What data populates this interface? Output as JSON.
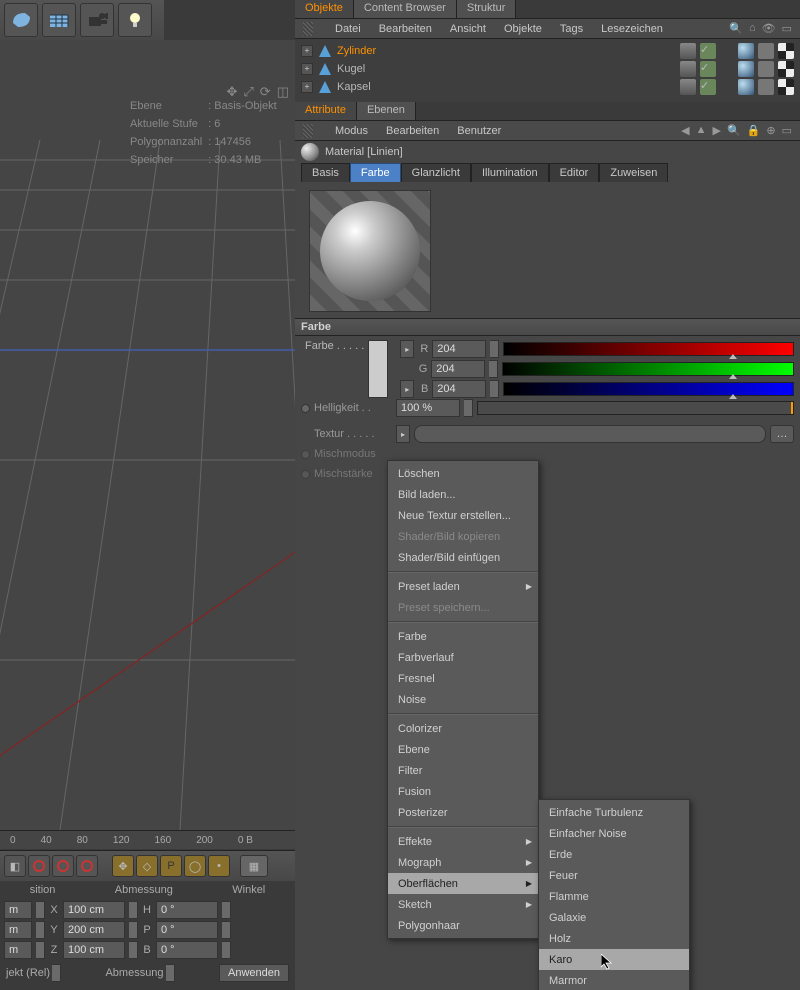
{
  "scene_info": {
    "rows": [
      [
        "Ebene",
        ": Basis-Objekt"
      ],
      [
        "Aktuelle Stufe",
        ": 6"
      ],
      [
        "Polygonanzahl",
        ": 147456"
      ],
      [
        "Speicher",
        ": 30.43 MB"
      ]
    ]
  },
  "ruler": [
    "0",
    "40",
    "80",
    "120",
    "160",
    "200",
    "0 B"
  ],
  "tabs_top": {
    "items": [
      "Objekte",
      "Content Browser",
      "Struktur"
    ],
    "active": "Objekte"
  },
  "obj_menu": {
    "items": [
      "Datei",
      "Bearbeiten",
      "Ansicht",
      "Objekte",
      "Tags",
      "Lesezeichen"
    ]
  },
  "objects": [
    {
      "name": "Zylinder",
      "selected": true
    },
    {
      "name": "Kugel",
      "selected": false
    },
    {
      "name": "Kapsel",
      "selected": false
    }
  ],
  "tabs_attr": {
    "items": [
      "Attribute",
      "Ebenen"
    ],
    "active": "Attribute"
  },
  "attr_menu": {
    "items": [
      "Modus",
      "Bearbeiten",
      "Benutzer"
    ]
  },
  "material_title": "Material [Linien]",
  "channels": {
    "items": [
      "Basis",
      "Farbe",
      "Glanzlicht",
      "Illumination",
      "Editor",
      "Zuweisen"
    ],
    "active": "Farbe"
  },
  "section_title": "Farbe",
  "color": {
    "label": "Farbe . . . . .",
    "r": "204",
    "g": "204",
    "b": "204"
  },
  "brightness": {
    "label": "Helligkeit . .",
    "value": "100 %"
  },
  "textur_label": "Textur . . . . .",
  "mixmode_label": "Mischmodus",
  "mixstrength_label": "Mischstärke",
  "menu1": [
    {
      "t": "Löschen"
    },
    {
      "t": "Bild laden..."
    },
    {
      "t": "Neue Textur erstellen..."
    },
    {
      "t": "Shader/Bild kopieren",
      "d": true
    },
    {
      "t": "Shader/Bild einfügen"
    },
    {
      "sep": true
    },
    {
      "t": "Preset laden",
      "sub": true
    },
    {
      "t": "Preset speichern...",
      "d": true
    },
    {
      "sep": true
    },
    {
      "t": "Farbe"
    },
    {
      "t": "Farbverlauf"
    },
    {
      "t": "Fresnel"
    },
    {
      "t": "Noise"
    },
    {
      "sep": true
    },
    {
      "t": "Colorizer"
    },
    {
      "t": "Ebene"
    },
    {
      "t": "Filter"
    },
    {
      "t": "Fusion"
    },
    {
      "t": "Posterizer"
    },
    {
      "sep": true
    },
    {
      "t": "Effekte",
      "sub": true
    },
    {
      "t": "Mograph",
      "sub": true
    },
    {
      "t": "Oberflächen",
      "sub": true,
      "hl": true
    },
    {
      "t": "Sketch",
      "sub": true
    },
    {
      "t": "Polygonhaar"
    }
  ],
  "menu2": [
    {
      "t": "Einfache Turbulenz"
    },
    {
      "t": "Einfacher Noise"
    },
    {
      "t": "Erde"
    },
    {
      "t": "Feuer"
    },
    {
      "t": "Flamme"
    },
    {
      "t": "Galaxie"
    },
    {
      "t": "Holz"
    },
    {
      "t": "Karo",
      "hl": true
    },
    {
      "t": "Marmor"
    }
  ],
  "transforms": {
    "headers": [
      "sition",
      "Abmessung",
      "Winkel"
    ],
    "rows": [
      {
        "unit": "m",
        "axis": "X",
        "dim": "100 cm",
        "axis2": "H",
        "ang": "0 °"
      },
      {
        "unit": "m",
        "axis": "Y",
        "dim": "200 cm",
        "axis2": "P",
        "ang": "0 °"
      },
      {
        "unit": "m",
        "axis": "Z",
        "dim": "100 cm",
        "axis2": "B",
        "ang": "0 °"
      }
    ],
    "footer": [
      "jekt (Rel)",
      "Abmessung",
      "Anwenden"
    ]
  }
}
